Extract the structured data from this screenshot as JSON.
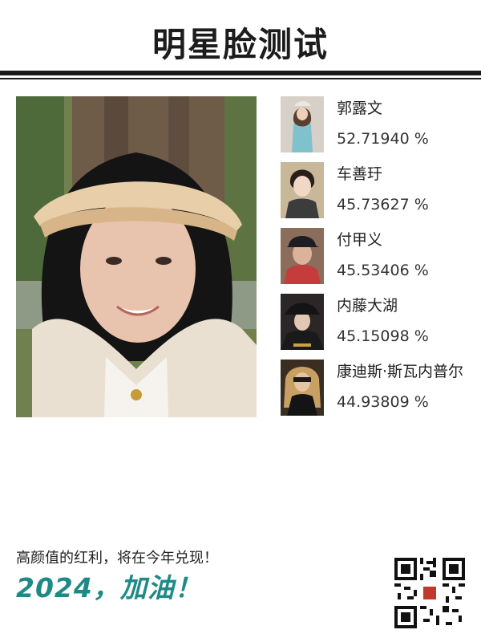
{
  "page": {
    "title": "明星脸测试"
  },
  "matches": [
    {
      "name": "郭露文",
      "score": "52.71940 %"
    },
    {
      "name": "车善玗",
      "score": "45.73627 %"
    },
    {
      "name": "付甲义",
      "score": "45.53406 %"
    },
    {
      "name": "内藤大湖",
      "score": "45.15098 %"
    },
    {
      "name": "康迪斯·斯瓦内普尔",
      "score": "44.93809 %"
    }
  ],
  "footer": {
    "slogan": "高颜值的红利，将在今年兑现！",
    "cheer": "2024，加油！"
  },
  "colors": {
    "accent": "#1e8a86",
    "rule": "#1a1a1a",
    "background": "#ffffff"
  },
  "icons": {
    "qr": "qr-code-icon"
  }
}
